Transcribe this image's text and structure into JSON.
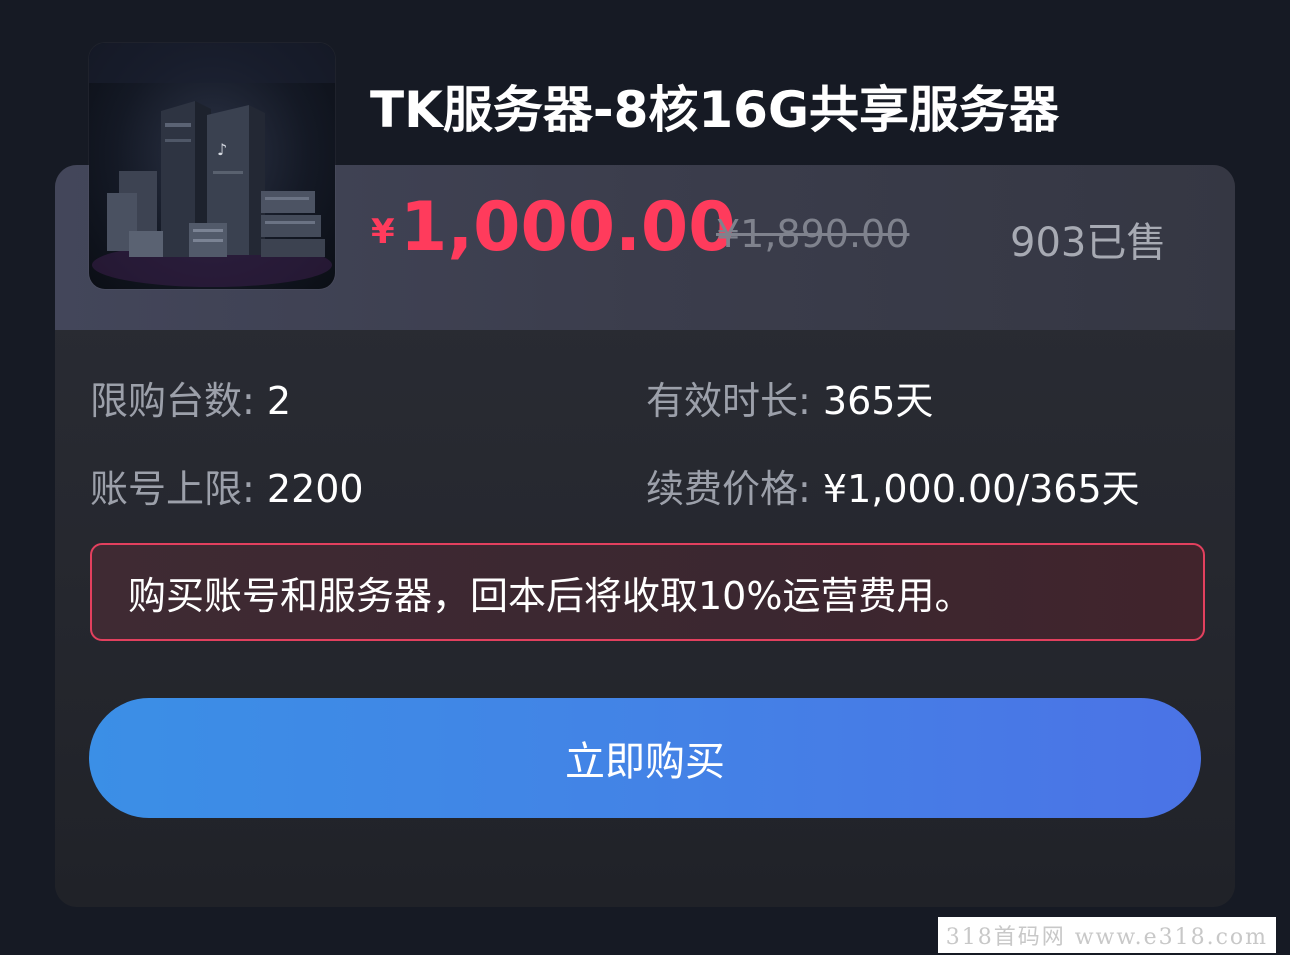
{
  "product": {
    "title": "TK服务器-8核16G共享服务器",
    "thumbnail_icon": "server-rack-image"
  },
  "pricing": {
    "currency_symbol": "¥",
    "price": "1,000.00",
    "original_price": "¥1,890.00",
    "sold": "903已售"
  },
  "specs": {
    "limit_label": "限购台数:",
    "limit_value": "2",
    "duration_label": "有效时长:",
    "duration_value": "365天",
    "account_label": "账号上限:",
    "account_value": "2200",
    "renew_label": "续费价格:",
    "renew_value": "¥1,000.00/365天"
  },
  "notice": "购买账号和服务器，回本后将收取10%运营费用。",
  "buy_button": "立即购买",
  "watermark": "318首码网  www.e318.com",
  "colors": {
    "price": "#ff3b5c",
    "button_start": "#3b8fe6",
    "button_end": "#4b73e6",
    "notice_border": "#e2405e"
  }
}
